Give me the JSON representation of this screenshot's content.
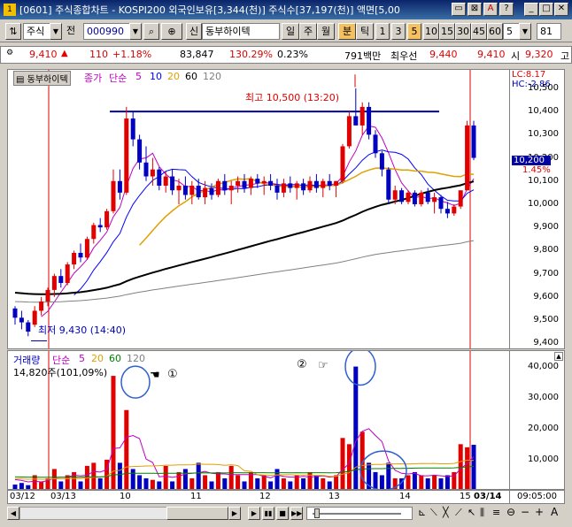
{
  "window": {
    "title": "[0601] 주식종합차트 - KOSPI200 외국인보유[3,344(천)] 주식수[37,197(천)] 액면[5,00",
    "app_icon": "1"
  },
  "toolbar": {
    "market": "주식",
    "prefix": "전",
    "code": "000990",
    "name_prefix": "신",
    "stock_name": "동부하이텍",
    "period_day": "일",
    "period_week": "주",
    "period_month": "월",
    "period_min": "분",
    "period_tick": "틱",
    "intervals": [
      "1",
      "3",
      "5",
      "10",
      "15",
      "30",
      "45",
      "60"
    ],
    "interval_value": "5",
    "count_value": "81"
  },
  "quote": {
    "price": "9,410",
    "change": "110",
    "change_pct": "+1.18%",
    "volume": "83,847",
    "vol_ratio": "130.29%",
    "turnover": "0.23%",
    "amount": "791백만",
    "best_ask_label": "최우선",
    "best_ask": "9,440",
    "best_bid": "9,410",
    "open_label": "시",
    "open": "9,320",
    "more": "고"
  },
  "price_pane": {
    "stock_tab": "동부하이텍",
    "legend_close": "종가",
    "legend_ma_type": "단순",
    "legend_ma": [
      "5",
      "10",
      "20",
      "60",
      "120"
    ],
    "high_annotation": "최고 10,500 (13:20)",
    "low_annotation": "최저 9,430 (14:40)",
    "lc_label": "LC:8.17",
    "hc_label": "HC:-2.86",
    "current_price": "10,200",
    "current_pct": "1.45%",
    "axis_ticks": [
      "10,500",
      "10,400",
      "10,300",
      "10,200",
      "10,100",
      "10,000",
      "9,900",
      "9,800",
      "9,700",
      "9,600",
      "9,500",
      "9,400"
    ]
  },
  "volume_pane": {
    "legend_title": "거래량",
    "legend_ma_type": "단순",
    "legend_ma": [
      "5",
      "20",
      "60",
      "120"
    ],
    "current_volume": "14,820주(101,09%)",
    "marker1": "①",
    "marker2": "②",
    "axis_ticks": [
      "40,000",
      "30,000",
      "20,000",
      "10,000"
    ]
  },
  "date_axis": {
    "labels": [
      "03/12",
      "03/13",
      "10",
      "11",
      "12",
      "13",
      "14",
      "15",
      "03/14"
    ],
    "time": "09:05:00"
  },
  "colors": {
    "up": "#e00000",
    "down": "#0000c0",
    "hline": "#0000a0",
    "ma5": "#c000c0",
    "ma10": "#0000ff",
    "ma20": "#e0a000",
    "ma60": "#000000",
    "ma120": "#808080"
  },
  "chart_data": {
    "type": "candlestick",
    "interval": "5분",
    "price_range": [
      9370,
      10580
    ],
    "volume_range": [
      0,
      45000
    ],
    "high": 10500,
    "low": 9430,
    "candles": [
      [
        9550,
        9560,
        9480,
        9510,
        2000
      ],
      [
        9510,
        9540,
        9460,
        9490,
        2500
      ],
      [
        9490,
        9500,
        9430,
        9450,
        1800
      ],
      [
        9480,
        9560,
        9470,
        9540,
        5000
      ],
      [
        9540,
        9600,
        9520,
        9580,
        3000
      ],
      [
        9580,
        9640,
        9560,
        9630,
        4000
      ],
      [
        9630,
        9700,
        9600,
        9690,
        7000
      ],
      [
        9690,
        9720,
        9640,
        9660,
        3000
      ],
      [
        9660,
        9750,
        9650,
        9740,
        5000
      ],
      [
        9740,
        9800,
        9720,
        9790,
        6000
      ],
      [
        9790,
        9830,
        9750,
        9770,
        3000
      ],
      [
        9770,
        9860,
        9760,
        9850,
        8000
      ],
      [
        9850,
        9920,
        9830,
        9910,
        9000
      ],
      [
        9910,
        9940,
        9880,
        9900,
        4000
      ],
      [
        9900,
        9980,
        9890,
        9970,
        10000
      ],
      [
        9970,
        10150,
        9960,
        10100,
        37000
      ],
      [
        10100,
        10150,
        10020,
        10050,
        9000
      ],
      [
        10050,
        10420,
        10040,
        10370,
        26000
      ],
      [
        10370,
        10400,
        10250,
        10280,
        7000
      ],
      [
        10280,
        10300,
        10150,
        10180,
        5000
      ],
      [
        10180,
        10250,
        10100,
        10120,
        4000
      ],
      [
        10120,
        10200,
        10080,
        10150,
        3500
      ],
      [
        10150,
        10160,
        10060,
        10080,
        3000
      ],
      [
        10080,
        10140,
        10050,
        10120,
        8000
      ],
      [
        10120,
        10150,
        10040,
        10060,
        3000
      ],
      [
        10060,
        10110,
        10000,
        10080,
        6000
      ],
      [
        10080,
        10120,
        10020,
        10040,
        7000
      ],
      [
        10040,
        10100,
        10000,
        10080,
        4000
      ],
      [
        10080,
        10110,
        10020,
        10030,
        9000
      ],
      [
        10030,
        10100,
        10000,
        10070,
        5000
      ],
      [
        10070,
        10090,
        10020,
        10040,
        3000
      ],
      [
        10040,
        10110,
        10030,
        10100,
        6000
      ],
      [
        10100,
        10130,
        10040,
        10060,
        4000
      ],
      [
        10060,
        10100,
        10000,
        10080,
        8000
      ],
      [
        10080,
        10120,
        10050,
        10100,
        5000
      ],
      [
        10100,
        10130,
        10050,
        10070,
        3000
      ],
      [
        10070,
        10120,
        10040,
        10110,
        6000
      ],
      [
        10110,
        10130,
        10070,
        10090,
        4000
      ],
      [
        10090,
        10120,
        10040,
        10100,
        5000
      ],
      [
        10100,
        10130,
        10060,
        10080,
        3000
      ],
      [
        10080,
        10110,
        10020,
        10050,
        7000
      ],
      [
        10050,
        10110,
        10030,
        10090,
        4000
      ],
      [
        10090,
        10120,
        10050,
        10070,
        3000
      ],
      [
        10070,
        10100,
        10020,
        10090,
        5000
      ],
      [
        10090,
        10110,
        10040,
        10060,
        4000
      ],
      [
        10060,
        10120,
        10050,
        10100,
        6000
      ],
      [
        10100,
        10130,
        10050,
        10070,
        5000
      ],
      [
        10070,
        10110,
        10030,
        10100,
        4000
      ],
      [
        10100,
        10130,
        10060,
        10080,
        3000
      ],
      [
        10080,
        10100,
        10030,
        10100,
        5000
      ],
      [
        10100,
        10260,
        10090,
        10250,
        17000
      ],
      [
        10250,
        10400,
        10240,
        10380,
        15000
      ],
      [
        10380,
        10500,
        10360,
        10340,
        40000
      ],
      [
        10340,
        10440,
        10300,
        10420,
        19000
      ],
      [
        10420,
        10440,
        10280,
        10300,
        9000
      ],
      [
        10300,
        10320,
        10200,
        10220,
        6000
      ],
      [
        10220,
        10230,
        10120,
        10150,
        5000
      ],
      [
        10150,
        10160,
        10000,
        10020,
        9000
      ],
      [
        10020,
        10080,
        10000,
        10060,
        4000
      ],
      [
        10060,
        10070,
        10000,
        10010,
        4000
      ],
      [
        10010,
        10060,
        10000,
        10050,
        5000
      ],
      [
        10050,
        10060,
        9990,
        10000,
        6000
      ],
      [
        10000,
        10060,
        9990,
        10050,
        5000
      ],
      [
        10050,
        10070,
        10000,
        10010,
        4000
      ],
      [
        10010,
        10050,
        9960,
        10030,
        5000
      ],
      [
        10030,
        10040,
        9960,
        9980,
        4000
      ],
      [
        9980,
        10010,
        9940,
        9960,
        5000
      ],
      [
        9960,
        10000,
        9950,
        9990,
        6000
      ],
      [
        9990,
        10050,
        9980,
        10060,
        15000
      ],
      [
        10060,
        10360,
        10060,
        10340,
        14000
      ],
      [
        10340,
        10360,
        10190,
        10200,
        14800
      ]
    ]
  }
}
